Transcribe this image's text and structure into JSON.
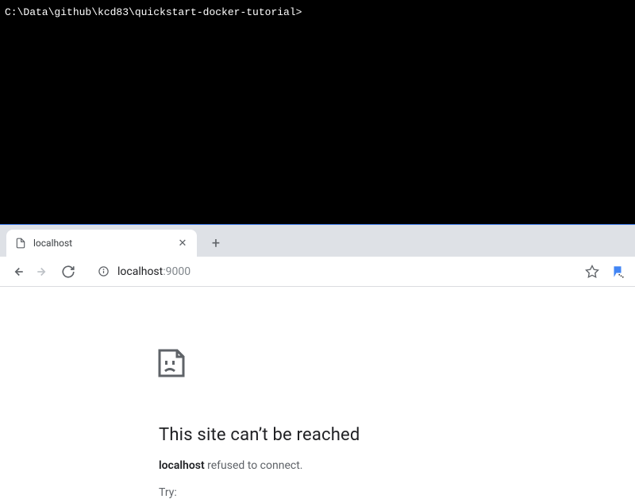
{
  "terminal": {
    "prompt": "C:\\Data\\github\\kcd83\\quickstart-docker-tutorial>"
  },
  "browser": {
    "tab": {
      "title": "localhost"
    },
    "url": {
      "host": "localhost",
      "port": ":9000"
    },
    "error": {
      "title": "This site can’t be reached",
      "host": "localhost",
      "refused": " refused to connect.",
      "try": "Try:"
    }
  }
}
